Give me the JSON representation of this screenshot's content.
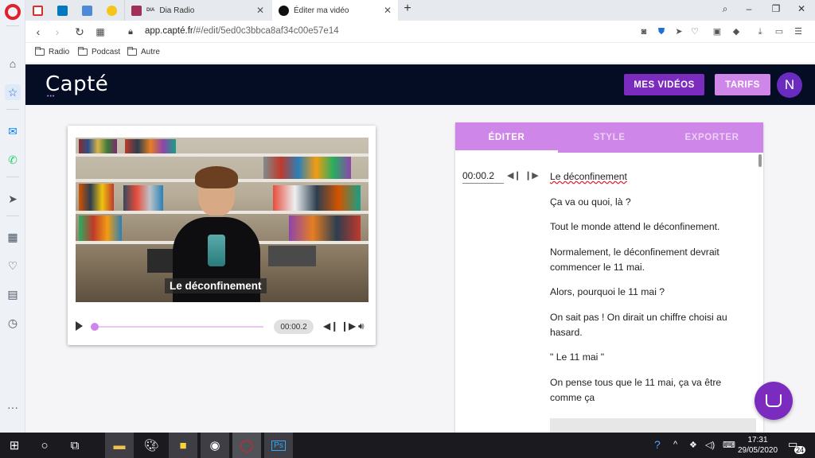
{
  "browser": {
    "tabs": [
      {
        "title": "Dia Radio"
      },
      {
        "title": "Éditer ma vidéo"
      }
    ],
    "url_host": "app.capté.fr",
    "url_path": "/#/edit/5ed0c3bbca8af34c00e57e14",
    "bookmarks": [
      "Radio",
      "Podcast",
      "Autre"
    ]
  },
  "app": {
    "logo": "Capté",
    "nav": {
      "videos": "MES VIDÉOS",
      "pricing": "TARIFS"
    },
    "avatar_initial": "N"
  },
  "player": {
    "subtitle": "Le déconfinement",
    "time": "00:00.2",
    "progress": 0.01
  },
  "editor": {
    "tabs": [
      {
        "label": "ÉDITER",
        "active": true
      },
      {
        "label": "STYLE",
        "active": false
      },
      {
        "label": "EXPORTER",
        "active": false
      }
    ],
    "timecode": "00:00.2",
    "lines": [
      "Le déconfinement",
      " Ça va ou quoi, là ?",
      "Tout le monde attend le déconfinement.",
      "Normalement, le déconfinement devrait commencer le 11 mai.",
      "Alors, pourquoi le 11 mai ?",
      "On sait pas ! On dirait un chiffre choisi au hasard.",
      "\" Le 11 mai \"",
      "On pense tous que le 11 mai, ça va être comme ça"
    ]
  },
  "taskbar": {
    "time": "17:31",
    "date": "29/05/2020",
    "notifications": "24"
  },
  "colors": {
    "header_bg": "#050d24",
    "primary": "#7b2cbf",
    "accent": "#cf86e9"
  }
}
